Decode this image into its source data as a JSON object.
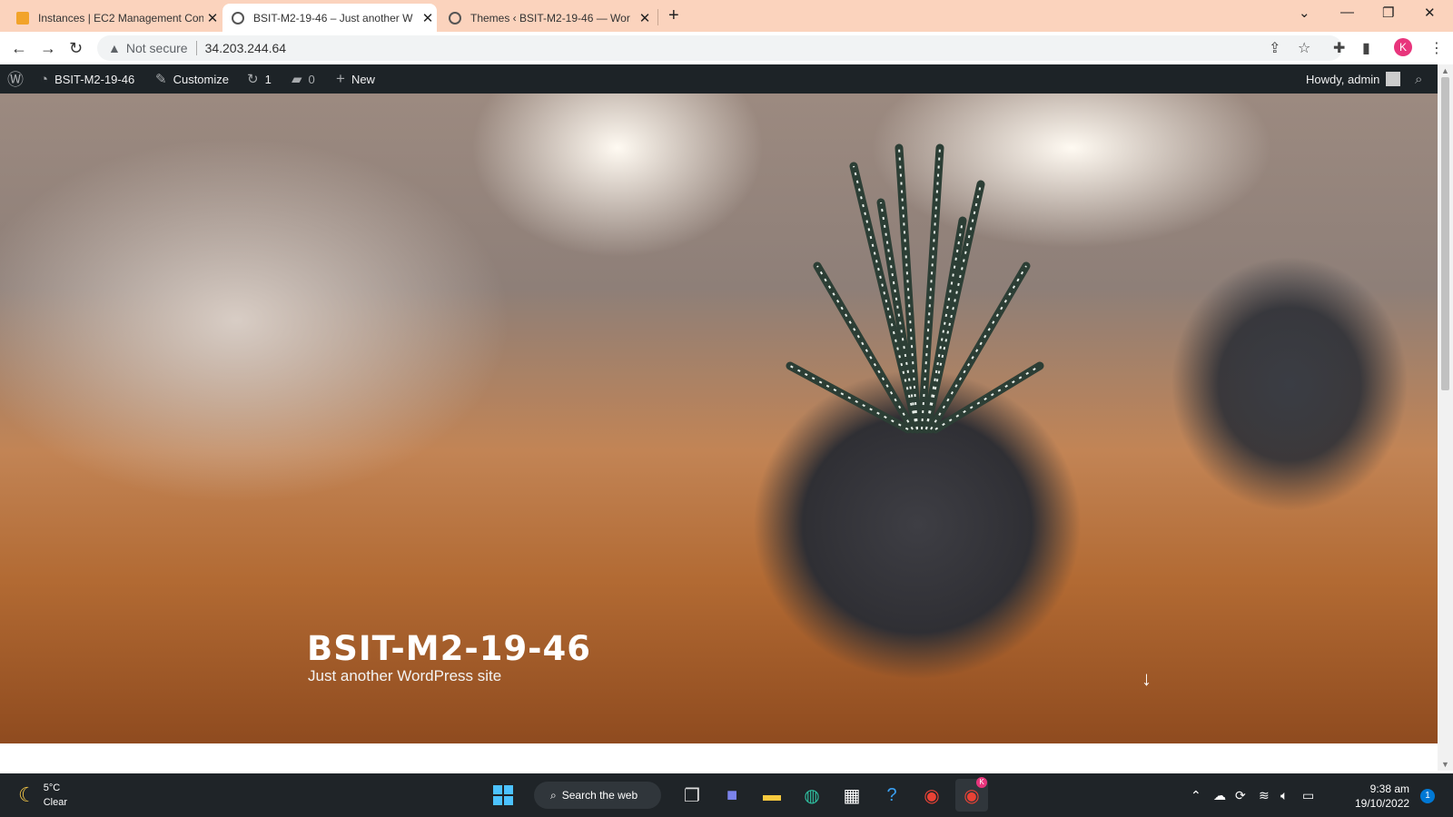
{
  "browser": {
    "tabs": [
      {
        "title": "Instances | EC2 Management Con",
        "icon": "aws-icon",
        "active": false
      },
      {
        "title": "BSIT-M2-19-46 – Just another W",
        "icon": "globe-icon",
        "active": true
      },
      {
        "title": "Themes ‹ BSIT-M2-19-46 — Wor",
        "icon": "globe-icon",
        "active": false
      }
    ],
    "security_label": "Not secure",
    "url": "34.203.244.64",
    "profile_initial": "K"
  },
  "wp_admin_bar": {
    "site_name": "BSIT-M2-19-46",
    "customize_label": "Customize",
    "updates_count": "1",
    "comments_count": "0",
    "new_label": "New",
    "greeting": "Howdy, admin"
  },
  "hero": {
    "site_title": "BSIT-M2-19-46",
    "tagline": "Just another WordPress site"
  },
  "taskbar": {
    "temperature": "5°C",
    "condition": "Clear",
    "search_label": "Search the web",
    "time": "9:38 am",
    "date": "19/10/2022",
    "notification_count": "1",
    "chrome_badge": "K"
  },
  "colors": {
    "tabstrip": "#fbd3bd",
    "wp_admin_bar": "#1d2327",
    "taskbar": "#1f2428",
    "profile": "#e8357c"
  }
}
